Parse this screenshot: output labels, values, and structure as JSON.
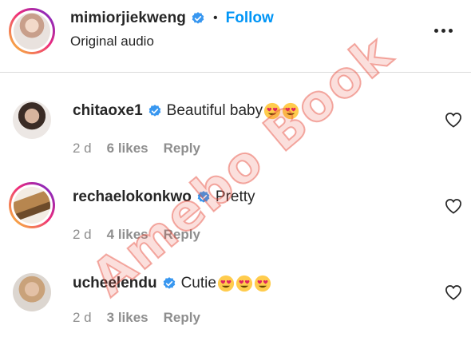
{
  "post": {
    "username": "mimiorjiekweng",
    "follow_label": "Follow",
    "dot": "•",
    "audio": "Original audio",
    "more_icon": "more-horizontal-icon"
  },
  "comments": [
    {
      "username": "chitaoxe1",
      "verified": true,
      "text": "Beautiful baby",
      "emoji_count": 2,
      "time": "2 d",
      "likes": "6 likes",
      "reply": "Reply"
    },
    {
      "username": "rechaelokonkwo",
      "verified": true,
      "text": "Pretty",
      "emoji_count": 0,
      "time": "2 d",
      "likes": "4 likes",
      "reply": "Reply"
    },
    {
      "username": "ucheelendu",
      "verified": true,
      "text": "Cutie",
      "emoji_count": 3,
      "time": "2 d",
      "likes": "3 likes",
      "reply": "Reply"
    }
  ],
  "watermark": "Amebo Book",
  "colors": {
    "accent": "#0095f6",
    "text": "#262626",
    "muted": "#8e8e8e",
    "verified": "#3897f0",
    "watermark": "#e74c3c"
  }
}
